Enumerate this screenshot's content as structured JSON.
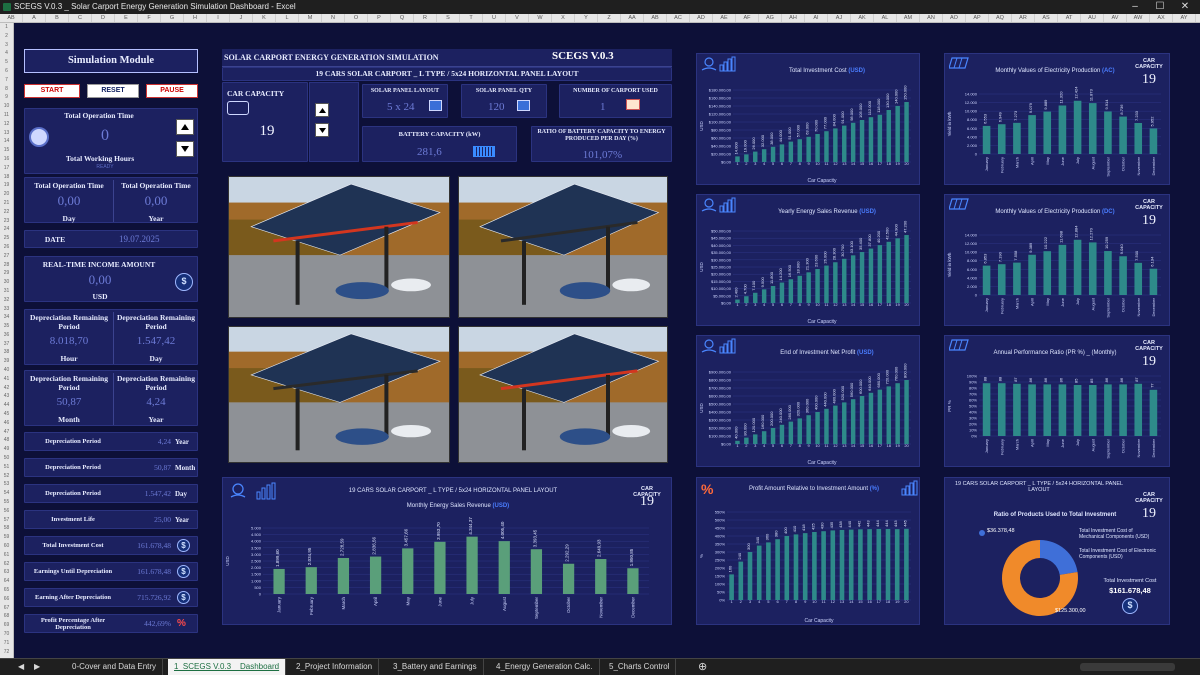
{
  "window": {
    "title": "SCEGS V.0.3 _ Solar Carport Energy Generation Simulation Dashboard - Excel"
  },
  "col_letters": [
    "AB",
    "A",
    "B",
    "C",
    "D",
    "E",
    "F",
    "G",
    "H",
    "I",
    "J",
    "K",
    "L",
    "M",
    "N",
    "O",
    "P",
    "Q",
    "R",
    "S",
    "T",
    "U",
    "V",
    "W",
    "X",
    "Y",
    "Z",
    "AA",
    "AB",
    "AC",
    "AD",
    "AE",
    "AF",
    "AG",
    "AH",
    "AI",
    "AJ",
    "AK",
    "AL",
    "AM",
    "AN",
    "AO",
    "AP",
    "AQ",
    "AR",
    "AS",
    "AT",
    "AU",
    "AV",
    "AW",
    "AX",
    "AY"
  ],
  "sim": {
    "title": "Simulation Module",
    "start": "START",
    "reset": "RESET",
    "pause": "PAUSE",
    "op_time_label": "Total Operation Time",
    "op_time_value": "0",
    "working_hours_label": "Total Working Hours",
    "ready": "READY",
    "op_day_label": "Total Operation Time",
    "op_day_value": "0,00",
    "op_day_unit": "Day",
    "op_year_label": "Total Operation Time",
    "op_year_value": "0,00",
    "op_year_unit": "Year",
    "date_label": "DATE",
    "date_value": "19.07.2025",
    "income_label": "REAL-TIME INCOME AMOUNT",
    "income_value": "0,00",
    "income_unit": "USD",
    "dep_hour_label": "Depreciation Remaining Period",
    "dep_hour_value": "8.018,70",
    "dep_hour_unit": "Hour",
    "dep_day_label": "Depreciation Remaining Period",
    "dep_day_value": "1.547,42",
    "dep_day_unit": "Day",
    "dep_month_label": "Depreciation Remaining Period",
    "dep_month_value": "50,87",
    "dep_month_unit": "Month",
    "dep_year_label": "Depreciation Remaining Period",
    "dep_year_value": "4,24",
    "dep_year_unit": "Year"
  },
  "metrics": [
    {
      "label": "Depreciation Period",
      "value": "4,24",
      "unit": "Year"
    },
    {
      "label": "Depreciation Period",
      "value": "50,87",
      "unit": "Month"
    },
    {
      "label": "Depreciation Period",
      "value": "1.547,42",
      "unit": "Day"
    },
    {
      "label": "Investment Life",
      "value": "25,00",
      "unit": "Year"
    },
    {
      "label": "Total Investment Cost",
      "value": "161.678,48",
      "unit": "$"
    },
    {
      "label": "Earnings Until Depreciation",
      "value": "161.678,48",
      "unit": "$"
    },
    {
      "label": "Earning After Depreciation",
      "value": "715.726,92",
      "unit": "$"
    },
    {
      "label": "Profit Percentage After Depreciation",
      "value": "442,69%",
      "unit": "%"
    }
  ],
  "header": {
    "title": "SOLAR CARPORT ENERGY GENERATION SIMULATION",
    "version": "SCEGS V.0.3",
    "subtitle": "19 CARS SOLAR CARPORT _ L TYPE  /  5x24 HORIZONTAL PANEL LAYOUT",
    "car_capacity_label": "CAR CAPACITY",
    "car_capacity_value": "19",
    "panel_layout_label": "SOLAR PANEL LAYOUT",
    "panel_layout_value": "5 x 24",
    "panel_qty_label": "SOLAR PANEL QTY",
    "panel_qty_value": "120",
    "carport_used_label": "NUMBER OF CARPORT USED",
    "carport_used_value": "1",
    "battery_label": "BATTERY CAPACITY (kW)",
    "battery_value": "281,6",
    "ratio_label": "RATIO OF BATTERY CAPACITY TO ENERGY PRODUCED PER DAY (%)",
    "ratio_value": "101,07%"
  },
  "bottom_chart": {
    "title": "19 CARS SOLAR CARPORT _ L TYPE  /  5x24 HORIZONTAL PANEL LAYOUT",
    "cap_label": "CAR CAPACITY",
    "cap_value": "19",
    "chart_title": "Monthly Energy Sales Revenue",
    "unit": "(USD)"
  },
  "chart_data": [
    {
      "type": "bar",
      "title": "Monthly Energy Sales Revenue (USD)",
      "ylabel": "USD",
      "categories": [
        "January",
        "February",
        "March",
        "April",
        "May",
        "June",
        "July",
        "August",
        "September",
        "October",
        "November",
        "December"
      ],
      "values": [
        1899.6,
        2034.95,
        2728.59,
        2836.56,
        3457.66,
        3953.7,
        4344.37,
        4005.4,
        3393.45,
        2292.29,
        2649.93,
        1950.85
      ],
      "ylim": [
        0,
        5000
      ],
      "labels": [
        "1.899,60",
        "2.034,95",
        "2.728,59",
        "2.836,56",
        "3.457,66",
        "3.953,70",
        "4.344,37",
        "4.005,40",
        "3.393,45",
        "2.292,29",
        "2.649,93",
        "1.950,85"
      ]
    },
    {
      "type": "bar",
      "title": "Total Investment Cost (USD)",
      "xlabel": "Car Capacity",
      "ylabel": "USD",
      "categories": [
        "1",
        "2",
        "3",
        "4",
        "5",
        "6",
        "7",
        "8",
        "9",
        "10",
        "11",
        "12",
        "13",
        "14",
        "15",
        "16",
        "17",
        "18",
        "19",
        "20"
      ],
      "values": [
        14000,
        19000,
        26000,
        32000,
        38000,
        44000,
        51000,
        57000,
        63000,
        70000,
        77000,
        84000,
        91000,
        98000,
        105000,
        112000,
        118000,
        130000,
        140000,
        150000
      ],
      "ylim": [
        0,
        180000
      ]
    },
    {
      "type": "bar",
      "title": "Yearly Energy Sales Revenue (USD)",
      "xlabel": "Car Capacity",
      "ylabel": "USD",
      "categories": [
        "1",
        "2",
        "3",
        "4",
        "5",
        "6",
        "7",
        "8",
        "9",
        "10",
        "11",
        "12",
        "13",
        "14",
        "15",
        "16",
        "17",
        "18",
        "19",
        "20"
      ],
      "values": [
        2400,
        4700,
        7100,
        9500,
        11800,
        14200,
        16500,
        18900,
        21300,
        23600,
        26000,
        28300,
        30700,
        33100,
        35400,
        37800,
        40200,
        42500,
        44900,
        47200
      ],
      "ylim": [
        0,
        50000
      ]
    },
    {
      "type": "bar",
      "title": "End of Investment Net Profit (USD)",
      "xlabel": "Car Capacity",
      "ylabel": "USD",
      "categories": [
        "1",
        "2",
        "3",
        "4",
        "5",
        "6",
        "7",
        "8",
        "9",
        "10",
        "11",
        "12",
        "13",
        "14",
        "15",
        "16",
        "17",
        "18",
        "19",
        "20"
      ],
      "values": [
        40000,
        80000,
        120000,
        160000,
        200000,
        240000,
        280000,
        320000,
        360000,
        400000,
        440000,
        480000,
        520000,
        560000,
        600000,
        640000,
        680000,
        720000,
        760000,
        800000
      ],
      "ylim": [
        0,
        900000
      ]
    },
    {
      "type": "bar",
      "title": "Profit Amount Relative to Investment Amount (%)",
      "xlabel": "Car Capacity",
      "ylabel": "%",
      "categories": [
        "1",
        "2",
        "3",
        "4",
        "5",
        "6",
        "7",
        "8",
        "9",
        "10",
        "11",
        "12",
        "13",
        "14",
        "15",
        "16",
        "17",
        "18",
        "19",
        "20"
      ],
      "values": [
        160,
        240,
        300,
        340,
        360,
        380,
        400,
        410,
        418,
        425,
        430,
        435,
        438,
        440,
        442,
        443,
        444,
        444,
        443,
        445
      ],
      "ylim": [
        0,
        550
      ]
    },
    {
      "type": "bar",
      "title": "Monthly Values of Electricity Production (AC)",
      "ylabel": "Yield in kWh",
      "categories": [
        "January",
        "February",
        "March",
        "April",
        "May",
        "June",
        "July",
        "August",
        "September",
        "October",
        "November",
        "December"
      ],
      "values": [
        6553,
        6949,
        7273,
        9079,
        9889,
        11320,
        12424,
        11873,
        9914,
        8736,
        7233,
        5952
      ],
      "ylim": [
        0,
        14000
      ]
    },
    {
      "type": "bar",
      "title": "Monthly Values of Electricity Production (DC)",
      "ylabel": "Yield in kWh",
      "categories": [
        "January",
        "February",
        "March",
        "April",
        "May",
        "June",
        "July",
        "August",
        "September",
        "October",
        "November",
        "December"
      ],
      "values": [
        6853,
        7190,
        7558,
        9389,
        10222,
        11698,
        12884,
        12270,
        10259,
        9040,
        7500,
        6134
      ],
      "ylim": [
        0,
        14000
      ]
    },
    {
      "type": "bar",
      "title": "Annual Performance Ratio (PR %) _ (Monthly)",
      "ylabel": "PR %",
      "categories": [
        "January",
        "February",
        "March",
        "April",
        "May",
        "June",
        "July",
        "August",
        "September",
        "October",
        "November",
        "December"
      ],
      "values": [
        88,
        88,
        87,
        86,
        86,
        86,
        85,
        85,
        86,
        86,
        87,
        77
      ],
      "ylim": [
        0,
        100
      ]
    },
    {
      "type": "pie",
      "title": "Ratio of Products Used to Total Investment",
      "categories": [
        "Total Investment Cost of Mechanical Components (USD)",
        "Total Investment Cost of Electronic Components (USD)"
      ],
      "values": [
        36378.48,
        125300
      ],
      "value_labels": [
        "$36.378,48",
        "$125.300,00"
      ]
    }
  ],
  "charts": {
    "tic": {
      "title": "Total Investment Cost",
      "unit": "(USD)",
      "xlabel": "Car Capacity"
    },
    "yesr": {
      "title": "Yearly Energy Sales Revenue",
      "unit": "(USD)",
      "xlabel": "Car Capacity"
    },
    "eoinp": {
      "title": "End of Investment Net Profit",
      "unit": "(USD)",
      "xlabel": "Car Capacity"
    },
    "pari": {
      "title": "Profit Amount Relative to Investment Amount",
      "unit": "(%)",
      "xlabel": "Car Capacity"
    },
    "ac": {
      "title": "Monthly Values of Electricity Production",
      "unit": "(AC)",
      "cap_label": "CAR CAPACITY",
      "cap_value": "19"
    },
    "dc": {
      "title": "Monthly Values of Electricity Production",
      "unit": "(DC)",
      "cap_label": "CAR CAPACITY",
      "cap_value": "19"
    },
    "pr": {
      "title": "Annual Performance Ratio (PR %) _ (Monthly)",
      "cap_label": "CAR CAPACITY",
      "cap_value": "19"
    },
    "pie": {
      "header": "19 CARS SOLAR CARPORT _ L TYPE  /  5x24 HORIZONTAL PANEL LAYOUT",
      "cap_label": "CAR CAPACITY",
      "cap_value": "19",
      "title": "Ratio of Products Used to Total Investment",
      "legend1": "Total Investment Cost of Mechanical Components (USD)",
      "legend2": "Total Investment Cost of Electronic Components (USD)",
      "val1": "$36.378,48",
      "val2": "$125.300,00",
      "total_label": "Total Investment Cost",
      "total_value": "$161.678,48"
    }
  },
  "tabs": [
    "0-Cover and Data Entry",
    "1_SCEGS V.0.3 _ Dashboard",
    "2_Project Information",
    "3_Battery and Earnings",
    "4_Energy Generation Calc.",
    "5_Charts Control"
  ],
  "colors": {
    "bar": "#5a9f7a",
    "bar_dark": "#2e8a8a",
    "pie_blue": "#3f6fd8",
    "pie_orange": "#f08a2a",
    "accent": "#4a7dff"
  }
}
